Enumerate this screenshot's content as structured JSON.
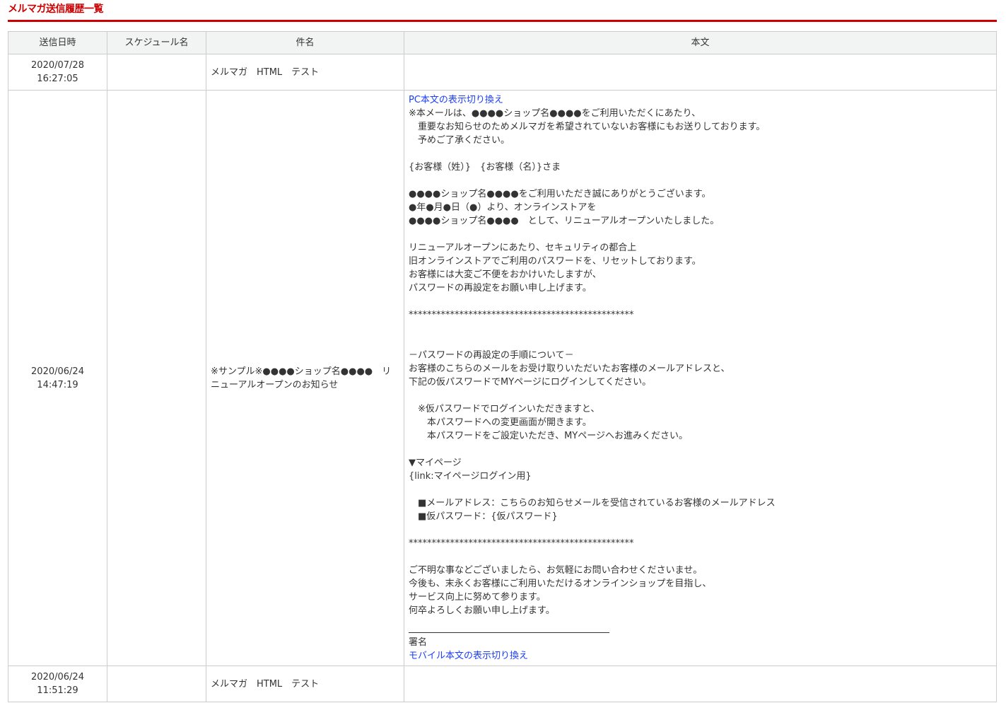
{
  "page": {
    "title": "メルマガ送信履歴一覧"
  },
  "table": {
    "headers": [
      "送信日時",
      "スケジュール名",
      "件名",
      "本文"
    ],
    "rows": [
      {
        "date": "2020/07/28",
        "time": "16:27:05",
        "schedule": "",
        "subject": "メルマガ　HTML　テスト",
        "body": ""
      },
      {
        "date": "2020/06/24",
        "time": "14:47:19",
        "schedule": "",
        "subject": "※サンプル※●●●●ショップ名●●●●　リニューアルオープンのお知らせ",
        "pc_toggle": "PC本文の表示切り換え",
        "body": "※本メールは、●●●●ショップ名●●●●をご利用いただくにあたり、\n　重要なお知らせのためメルマガを希望されていないお客様にもお送りしております。\n　予めご了承ください。\n\n{お客様（姓）}　{お客様（名）}さま\n\n●●●●ショップ名●●●●をご利用いただき誠にありがとうございます。\n●年●月●日（●）より、オンラインストアを\n●●●●ショップ名●●●●　として、リニューアルオープンいたしました。\n\nリニューアルオープンにあたり、セキュリティの都合上\n旧オンラインストアでご利用のパスワードを、リセットしております。\nお客様には大変ご不便をおかけいたしますが、\nパスワードの再設定をお願い申し上げます。\n\n*************************************************\n\n\n－パスワードの再設定の手順について－\nお客様のこちらのメールをお受け取りいただいたお客様のメールアドレスと、\n下記の仮パスワードでMYページにログインしてください。\n\n　※仮パスワードでログインいただきますと、\n　　本パスワードへの変更画面が開きます。\n　　本パスワードをご設定いただき、MYページへお進みください。\n\n▼マイページ\n{link:マイページログイン用}\n\n　■メールアドレス：こちらのお知らせメールを受信されているお客様のメールアドレス\n　■仮パスワード：{仮パスワード}\n\n*************************************************\n\nご不明な事などございましたら、お気軽にお問い合わせくださいませ。\n今後も、末永くお客様にご利用いただけるオンラインショップを目指し、\nサービス向上に努めて参ります。\n何卒よろしくお願い申し上げます。\n",
        "signature": "署名",
        "mobile_toggle": "モバイル本文の表示切り換え"
      },
      {
        "date": "2020/06/24",
        "time": "11:51:29",
        "schedule": "",
        "subject": "メルマガ　HTML　テスト",
        "body": ""
      }
    ]
  },
  "colors": {
    "accent": "#cc0000",
    "link": "#1a3dff",
    "header_bg": "#f2f4f3",
    "border": "#cccccc"
  }
}
